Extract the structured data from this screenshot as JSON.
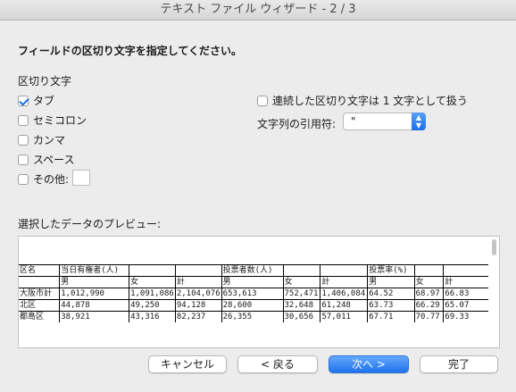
{
  "window": {
    "title": "テキスト ファイル ウィザード - 2 / 3"
  },
  "instruction": "フィールドの区切り文字を指定してください。",
  "delimiters": {
    "label": "区切り文字",
    "tab": "タブ",
    "semicolon": "セミコロン",
    "comma": "カンマ",
    "space": "スペース",
    "other": "その他:"
  },
  "options": {
    "consecutive": "連続した区切り文字は 1 文字として扱う",
    "quote_label": "文字列の引用符:",
    "quote_value": "\""
  },
  "preview": {
    "label": "選択したデータのプレビュー:",
    "rows": [
      [
        "区名",
        "当日有権者(人)",
        "",
        "",
        "投票者数(人)",
        "",
        "",
        "投票率(%)",
        "",
        ""
      ],
      [
        "",
        "男",
        "女",
        "計",
        "男",
        "女",
        "計",
        "男",
        "女",
        "計"
      ],
      [
        "大阪市計",
        "1,012,990",
        "1,091,086",
        "2,104,076",
        "653,613",
        "752,471",
        "1,406,084",
        "64.52",
        "68.97",
        "66.83"
      ],
      [
        "北区",
        "44,878",
        "49,250",
        "94,128",
        "28,600",
        "32,648",
        "61,248",
        "63.73",
        "66.29",
        "65.07"
      ],
      [
        "都島区",
        "38,921",
        "43,316",
        "82,237",
        "26,355",
        "30,656",
        "57,011",
        "67.71",
        "70.77",
        "69.33"
      ]
    ]
  },
  "buttons": {
    "cancel": "キャンセル",
    "back": "< 戻る",
    "next": "次へ >",
    "finish": "完了"
  },
  "colors": {
    "accent": "#1a73e8"
  }
}
